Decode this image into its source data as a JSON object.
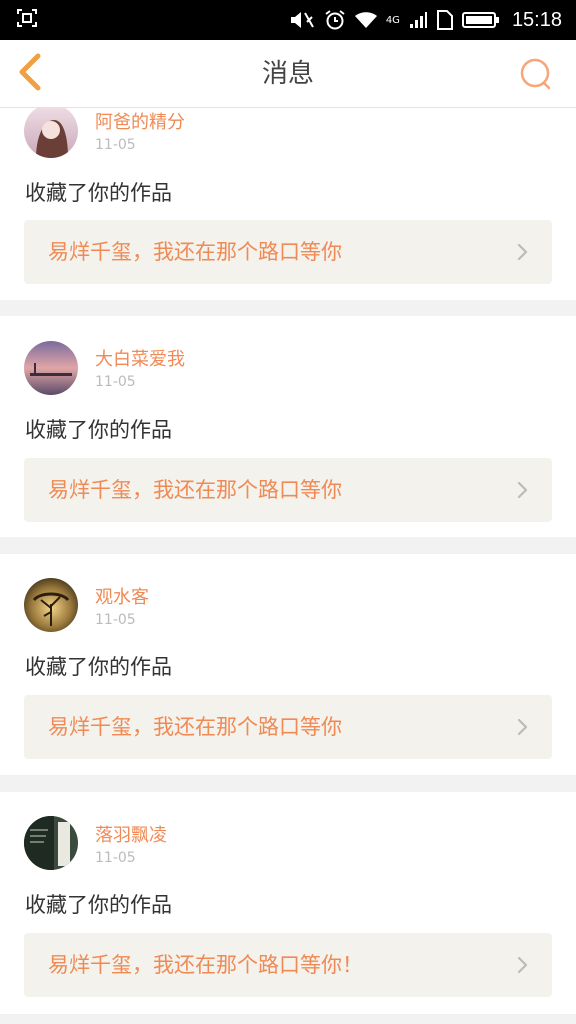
{
  "status_bar": {
    "time": "15:18",
    "network": "4G",
    "icons": [
      "screenshot-icon",
      "mute-icon",
      "alarm-icon",
      "wifi-icon",
      "signal-icon",
      "sim-icon",
      "battery-icon"
    ]
  },
  "header": {
    "title": "消息",
    "back_icon": "back-chevron-icon",
    "search_icon": "search-icon",
    "accent_color": "#f0a043"
  },
  "messages": [
    {
      "user": "阿爸的精分",
      "time": "11-05",
      "action": "收藏了你的作品",
      "work_title": "易烊千玺，我还在那个路口等你"
    },
    {
      "user": "大白菜爱我",
      "time": "11-05",
      "action": "收藏了你的作品",
      "work_title": "易烊千玺，我还在那个路口等你"
    },
    {
      "user": "观水客",
      "time": "11-05",
      "action": "收藏了你的作品",
      "work_title": "易烊千玺，我还在那个路口等你"
    },
    {
      "user": "落羽飘凌",
      "time": "11-05",
      "action": "收藏了你的作品",
      "work_title": "易烊千玺，我还在那个路口等你！"
    }
  ],
  "colors": {
    "name_color": "#f08a55",
    "link_background": "#f3f2ec",
    "divider": "#f2f2f2"
  }
}
